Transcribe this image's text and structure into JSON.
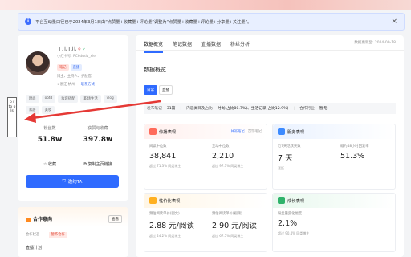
{
  "notice": {
    "text": "平台互动量口径已于2024年3月1日由“点赞量+收藏量+评论量”调整为“点赞量+收藏量+评论量+分享量+关注量”。",
    "close": "×"
  },
  "profile": {
    "name": "丁儿丁儿",
    "gender_icon": "♀",
    "verified_icon": "✓",
    "id": "小红书号: RC6dudu_xie",
    "tags": [
      "笔记",
      "直播"
    ],
    "meta": "博主、主持人、护肤官",
    "location": "浙江 杭州",
    "link": "联系方式",
    "chips": [
      "时尚",
      "ootd",
      "妆容搭配",
      "职场生活",
      "vlog",
      "家居",
      "美妆"
    ],
    "fans_label": "粉丝数",
    "fans_value": "51.8w",
    "likes_label": "获赞与收藏",
    "likes_value": "397.8w",
    "collect_label": "收藏",
    "copy_label": "复制主页链接",
    "invite_label": "邀约TA"
  },
  "cooperation": {
    "title": "合作意向",
    "button": "查看",
    "status_label": "合作状态",
    "status_value": "暂不合作",
    "plan_label": "直播计划"
  },
  "sidebar_tab": {
    "label": "p r to o ls"
  },
  "main": {
    "tabs": [
      "数据概览",
      "笔记数据",
      "直播数据",
      "粉丝分析"
    ],
    "updated": "数据更新至: 2024-09-18",
    "section_title": "数据概览",
    "period_tabs": [
      "日常",
      "直播"
    ],
    "meta_row": {
      "notes_label": "发布笔记",
      "notes_value": "31篇",
      "content_label": "内容类目及占比",
      "content_value": "时尚(占比80.7%)、生活记录(占比12.9%)",
      "industry_label": "合作行业",
      "industry_value": "暂无"
    },
    "cards": {
      "spread": {
        "title": "传播表现",
        "link_daily": "日常笔记",
        "link_coop": "合作笔记",
        "m1_label": "阅读中位数",
        "m1_value": "38,841",
        "m1_sub": "超过 71.3% 同类博主",
        "m2_label": "互动中位数",
        "m2_value": "2,210",
        "m2_sub": "超过 97.3% 同类博主"
      },
      "service": {
        "title": "服务表现",
        "m1_label": "近7天活跃天数",
        "m1_value": "7 天",
        "m1_sub": "活跃",
        "m2_label": "邀约48小时回复率",
        "m2_value": "51.3%"
      },
      "value": {
        "title": "性价比表现",
        "m1_label": "预估阅读单价(图文)",
        "m1_value": "2.88 元/阅读",
        "m1_sub": "超过 24.2% 同类博主",
        "m2_label": "预估阅读单价(视频)",
        "m2_value": "2.90 元/阅读",
        "m2_sub": "超过 67.5% 同类博主"
      },
      "growth": {
        "title": "成长表现",
        "m1_label": "粉丝量变化幅度",
        "m1_value": "2.1%",
        "m1_sub": "超过 90.4% 同类博主"
      }
    }
  },
  "colors": {
    "accent": "#2f6bff",
    "arrow": "#e53935"
  }
}
